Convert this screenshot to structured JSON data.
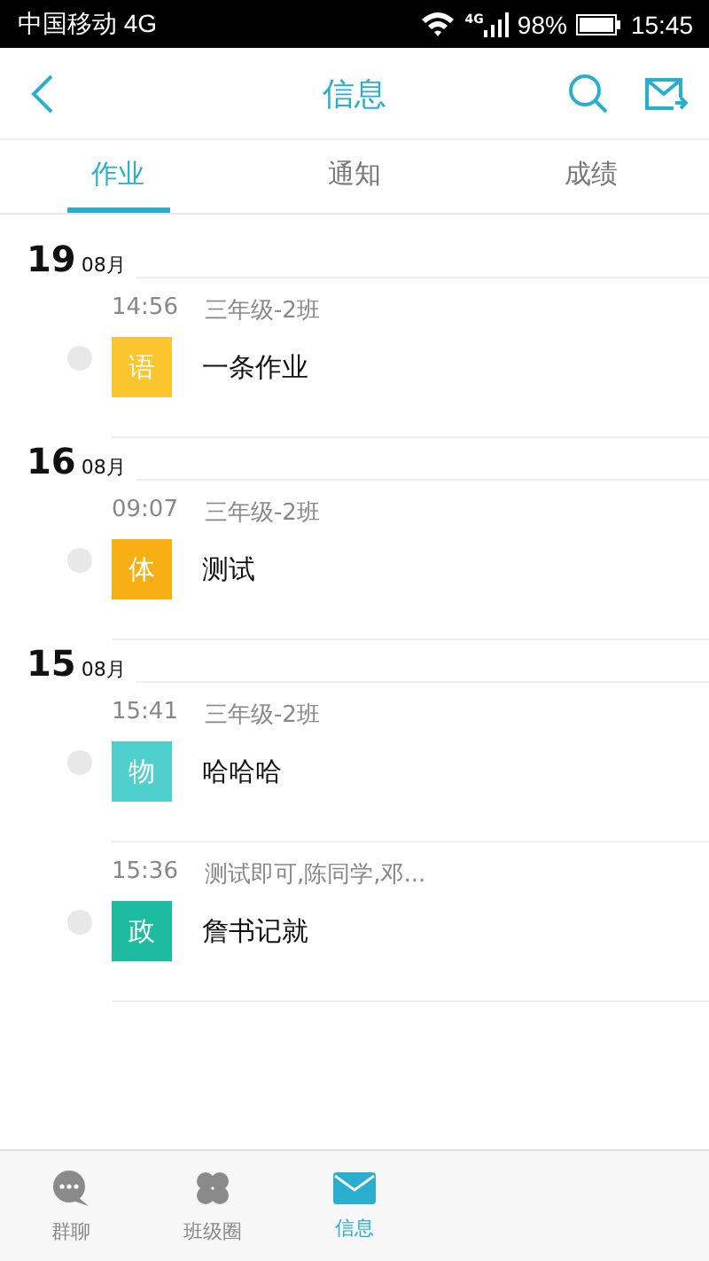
{
  "status_bar": {
    "carrier": "中国移动 4G",
    "network": "4G",
    "battery": "98%",
    "time": "15:45"
  },
  "header": {
    "title": "信息"
  },
  "tabs": [
    {
      "label": "作业",
      "selected": true
    },
    {
      "label": "通知",
      "selected": false
    },
    {
      "label": "成绩",
      "selected": false
    }
  ],
  "groups": [
    {
      "day": "19",
      "month": "08月",
      "items": [
        {
          "time": "14:56",
          "recipients": "三年级-2班",
          "subject": "语",
          "color": "#fbc62d",
          "title": "一条作业"
        }
      ]
    },
    {
      "day": "16",
      "month": "08月",
      "items": [
        {
          "time": "09:07",
          "recipients": "三年级-2班",
          "subject": "体",
          "color": "#f8af13",
          "title": "测试"
        }
      ]
    },
    {
      "day": "15",
      "month": "08月",
      "items": [
        {
          "time": "15:41",
          "recipients": "三年级-2班",
          "subject": "物",
          "color": "#4fd0cf",
          "title": "哈哈哈"
        },
        {
          "time": "15:36",
          "recipients": "测试即可,陈同学,邓...",
          "subject": "政",
          "color": "#1dbba0",
          "title": "詹书记就"
        }
      ]
    }
  ],
  "bottom_nav": [
    {
      "label": "群聊",
      "kind": "chat",
      "selected": false
    },
    {
      "label": "班级圈",
      "kind": "clover",
      "selected": false
    },
    {
      "label": "信息",
      "kind": "mail",
      "selected": true
    }
  ]
}
